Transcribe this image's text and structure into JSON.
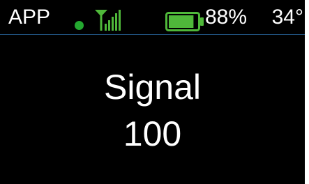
{
  "status_bar": {
    "app_label": "APP",
    "status_dot": {
      "icon": "connection-status-dot-icon",
      "color": "#24a830"
    },
    "signal_icon": {
      "icon": "signal-strength-icon",
      "color": "#4fb83a",
      "level": 1.0
    },
    "battery": {
      "icon": "battery-icon",
      "color": "#4fb83a",
      "level_label": "88%",
      "level": 0.88
    },
    "temperature": "34°"
  },
  "main": {
    "title": "Signal",
    "value": "100"
  },
  "colors": {
    "background": "#000000",
    "text": "#ffffff",
    "divider": "#1f4f7a",
    "accent_green": "#4fb83a"
  }
}
